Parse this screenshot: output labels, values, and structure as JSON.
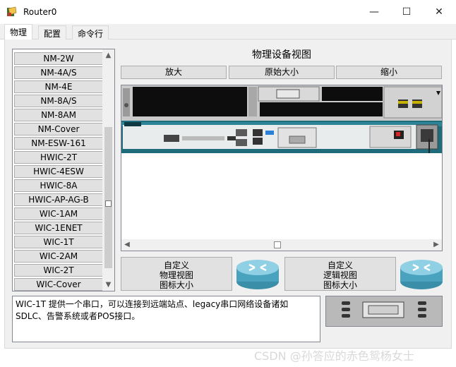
{
  "window": {
    "title": "Router0",
    "minimize": "—",
    "maximize": "☐",
    "close": "✕"
  },
  "tabs": [
    "物理",
    "配置",
    "命令行"
  ],
  "modules": [
    "NM-2W",
    "NM-4A/S",
    "NM-4E",
    "NM-8A/S",
    "NM-8AM",
    "NM-Cover",
    "NM-ESW-161",
    "HWIC-2T",
    "HWIC-4ESW",
    "HWIC-8A",
    "HWIC-AP-AG-B",
    "WIC-1AM",
    "WIC-1ENET",
    "WIC-1T",
    "WIC-2AM",
    "WIC-2T",
    "WIC-Cover"
  ],
  "view": {
    "title": "物理设备视图",
    "zoom_in": "放大",
    "original_size": "原始大小",
    "zoom_out": "缩小"
  },
  "custom_physical": [
    "自定义",
    "物理视图",
    "图标大小"
  ],
  "custom_logical": [
    "自定义",
    "逻辑视图",
    "图标大小"
  ],
  "description": "WIC-1T 提供一个串口，可以连接到远端站点、legacy串口网络设备诸如SDLC、告警系统或者POS接口。",
  "watermark": "CSDN @孙答应的赤色鸳杨女士",
  "scroll": {
    "up": "▲",
    "down": "▼",
    "left": "◀",
    "right": "▶"
  }
}
